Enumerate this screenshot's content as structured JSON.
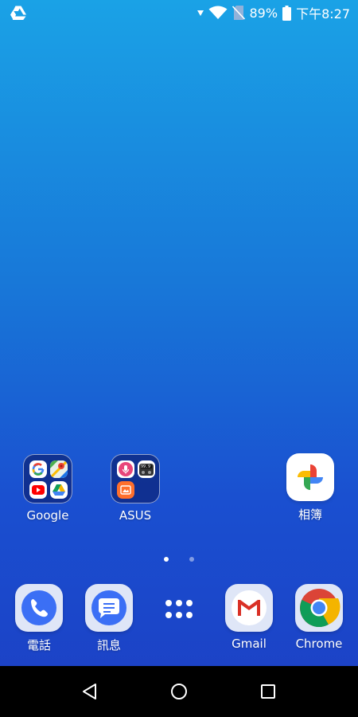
{
  "status_bar": {
    "battery_percent": "89%",
    "time": "下午8:27",
    "icons": [
      "drive-icon",
      "signal-arrow-icon",
      "wifi-icon",
      "no-sim-icon",
      "battery-icon"
    ]
  },
  "home": {
    "folders": [
      {
        "label": "Google",
        "apps": [
          "google-icon",
          "maps-icon",
          "youtube-icon",
          "drive-icon"
        ]
      },
      {
        "label": "ASUS",
        "apps": [
          "voice-icon",
          "radio-icon",
          "gallery-icon"
        ],
        "radio_text": "99.9"
      }
    ],
    "apps": [
      {
        "label": "相簿",
        "icon": "photos-icon"
      }
    ]
  },
  "page_indicator": {
    "count": 2,
    "active": 0
  },
  "dock": [
    {
      "label": "電話",
      "icon": "phone-icon"
    },
    {
      "label": "訊息",
      "icon": "messages-icon"
    },
    {
      "label": "",
      "icon": "app-drawer-icon"
    },
    {
      "label": "Gmail",
      "icon": "gmail-icon"
    },
    {
      "label": "Chrome",
      "icon": "chrome-icon"
    }
  ],
  "nav_bar": {
    "buttons": [
      "back-icon",
      "home-icon",
      "recents-icon"
    ]
  },
  "colors": {
    "wallpaper_top": "#1aa2e6",
    "wallpaper_bottom": "#1c3fc4",
    "dock_ring": "#dfe6f7",
    "phone_blue": "#3b6ff5"
  }
}
